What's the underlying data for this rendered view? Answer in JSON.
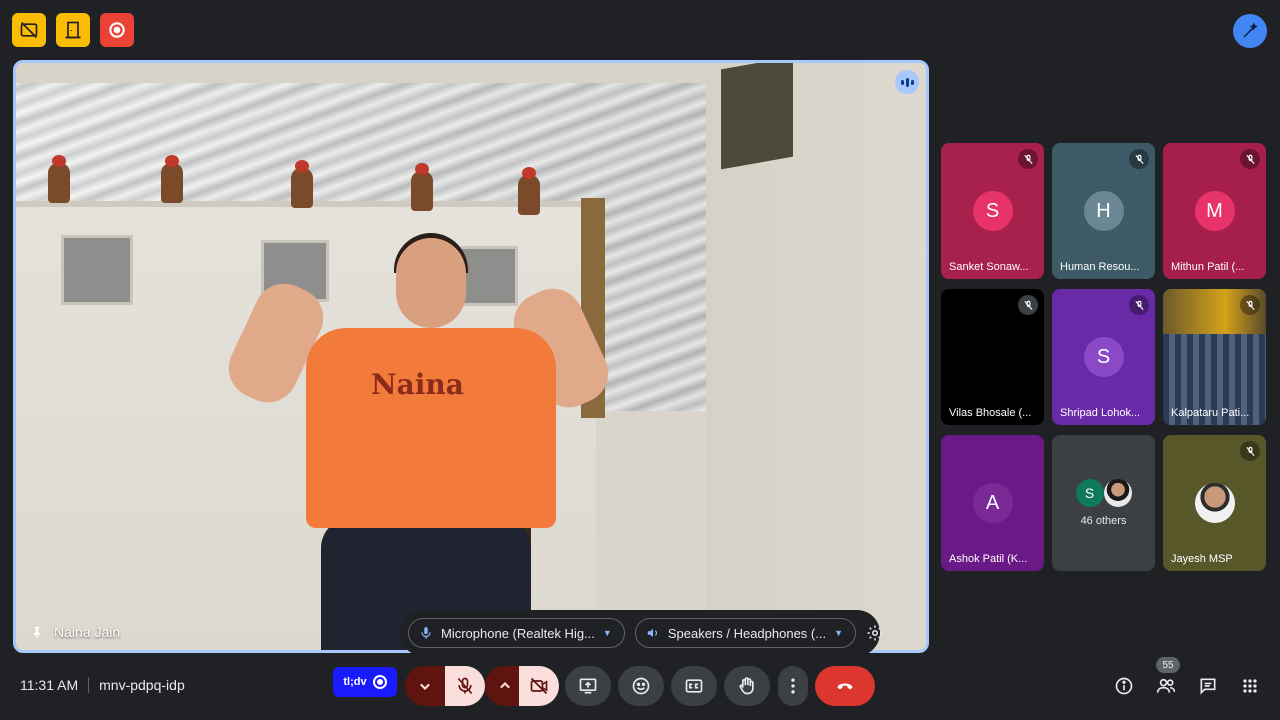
{
  "top_badges": [
    {
      "icon": "no-screenshot-icon",
      "color": "#fbbc04"
    },
    {
      "icon": "door-icon",
      "color": "#fbbc04"
    },
    {
      "icon": "record-icon",
      "color": "#ea4335"
    }
  ],
  "main_speaker": {
    "name": "Naina Jain",
    "shirt_text": "Naina",
    "highlight_color": "#a8c7fa"
  },
  "device_bar": {
    "microphone": "Microphone (Realtek Hig...",
    "speakers": "Speakers / Headphones (..."
  },
  "participants": [
    {
      "name": "Sanket Sonaw...",
      "initial": "S",
      "tile_color": "#a8204c",
      "avatar_color": "#e8336a",
      "muted": true
    },
    {
      "name": "Human Resou...",
      "initial": "H",
      "tile_color": "#3d5a66",
      "avatar_color": "#6a8793",
      "muted": true
    },
    {
      "name": "Mithun Patil (...",
      "initial": "M",
      "tile_color": "#a51e4e",
      "avatar_color": "#e8336a",
      "muted": true
    },
    {
      "name": "Vilas Bhosale (...",
      "initial": "",
      "tile_color": "#000000",
      "avatar_color": "#000000",
      "muted": true
    },
    {
      "name": "Shripad Lohok...",
      "initial": "S",
      "tile_color": "#6a2aa8",
      "avatar_color": "#8a4ac8",
      "muted": true
    },
    {
      "name": "Kalpataru Pati...",
      "initial": "",
      "tile_color": "#2f3b4a",
      "avatar_color": "",
      "muted": true
    },
    {
      "name": "Ashok Patil (K...",
      "initial": "A",
      "tile_color": "#6a1a86",
      "avatar_color": "#7a2a96",
      "muted": false
    },
    {
      "name": "",
      "initial": "S",
      "tile_color": "#3c4043",
      "avatar_color": "#0f7a5a",
      "muted": false
    },
    {
      "name": "Jayesh MSP",
      "initial": "",
      "tile_color": "#57572a",
      "avatar_color": "",
      "muted": true
    }
  ],
  "others": {
    "label": "46 others",
    "initial": "S"
  },
  "meeting": {
    "time": "11:31 AM",
    "code": "mnv-pdpq-idp"
  },
  "controls": {
    "captions_chip": "tl;dv"
  },
  "people_count": "55"
}
